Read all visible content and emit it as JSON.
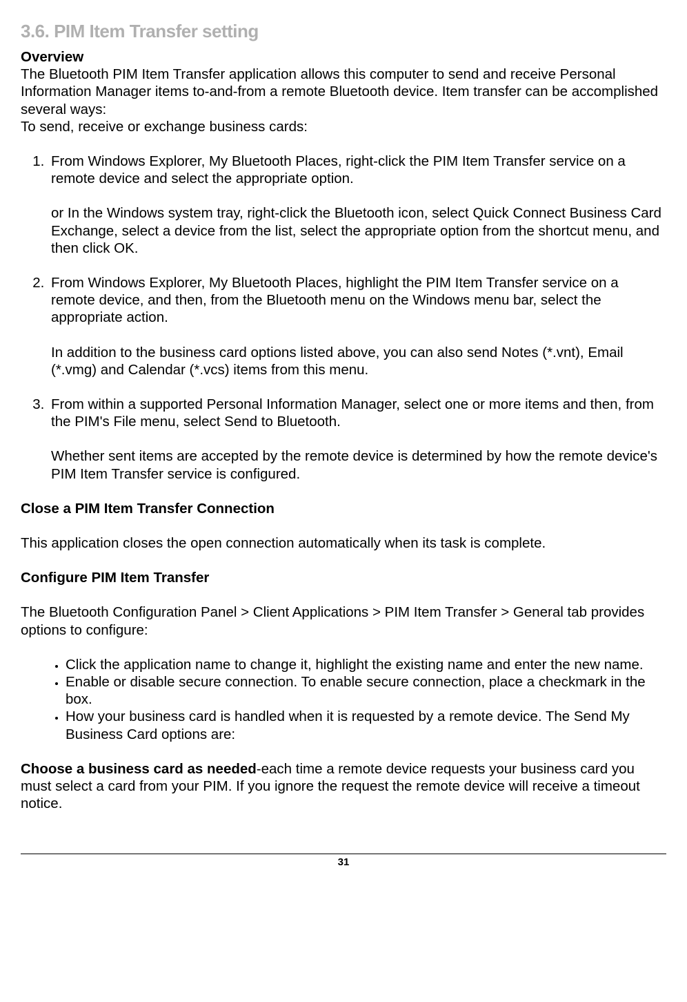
{
  "title": "3.6. PIM Item Transfer setting",
  "overview_label": "Overview",
  "overview_text": "The Bluetooth PIM Item Transfer application allows this computer to send and receive Personal Information Manager items to-and-from a remote Bluetooth device. Item transfer can be accomplished several ways:",
  "to_send": "To send, receive or exchange business cards:",
  "item1a": "From Windows Explorer, My Bluetooth Places, right-click the PIM Item Transfer service on a remote device and select the appropriate option.",
  "item1b": "or In the Windows system tray, right-click the Bluetooth icon, select Quick Connect Business Card Exchange, select a device from the list, select the appropriate option from the shortcut menu, and then click OK.",
  "item2a": "From Windows Explorer, My Bluetooth Places, highlight the PIM Item Transfer service on a remote device, and then, from the Bluetooth menu on the Windows menu bar, select the appropriate action.",
  "item2b": "In addition to the business card options listed above, you can also send Notes (*.vnt), Email (*.vmg) and Calendar (*.vcs) items from this menu.",
  "item3a": "From within a supported Personal Information Manager, select one or more items and then, from the PIM's File menu, select Send to Bluetooth.",
  "item3b": "Whether sent items are accepted by the remote device is determined by how the remote device's PIM Item Transfer service is configured.",
  "close_heading": "Close a PIM Item Transfer Connection",
  "close_text": "This application closes the open connection automatically when its task is complete.",
  "config_heading": "Configure PIM Item Transfer",
  "config_text": "The Bluetooth Configuration Panel > Client Applications > PIM Item Transfer > General tab provides options to configure:",
  "bullet1": " Click the application name to change it, highlight the existing name and enter the new name.",
  "bullet2": "Enable or disable secure connection. To enable secure connection, place a checkmark in the box.",
  "bullet3": "How your business card is handled when it is requested by a remote device. The Send My Business Card options are:",
  "choose_bold": "Choose a business card as needed",
  "choose_rest": "-each time a remote device requests your business card you must select a card from your PIM. If you ignore the request the remote device will receive a timeout notice.",
  "page_num": "31"
}
